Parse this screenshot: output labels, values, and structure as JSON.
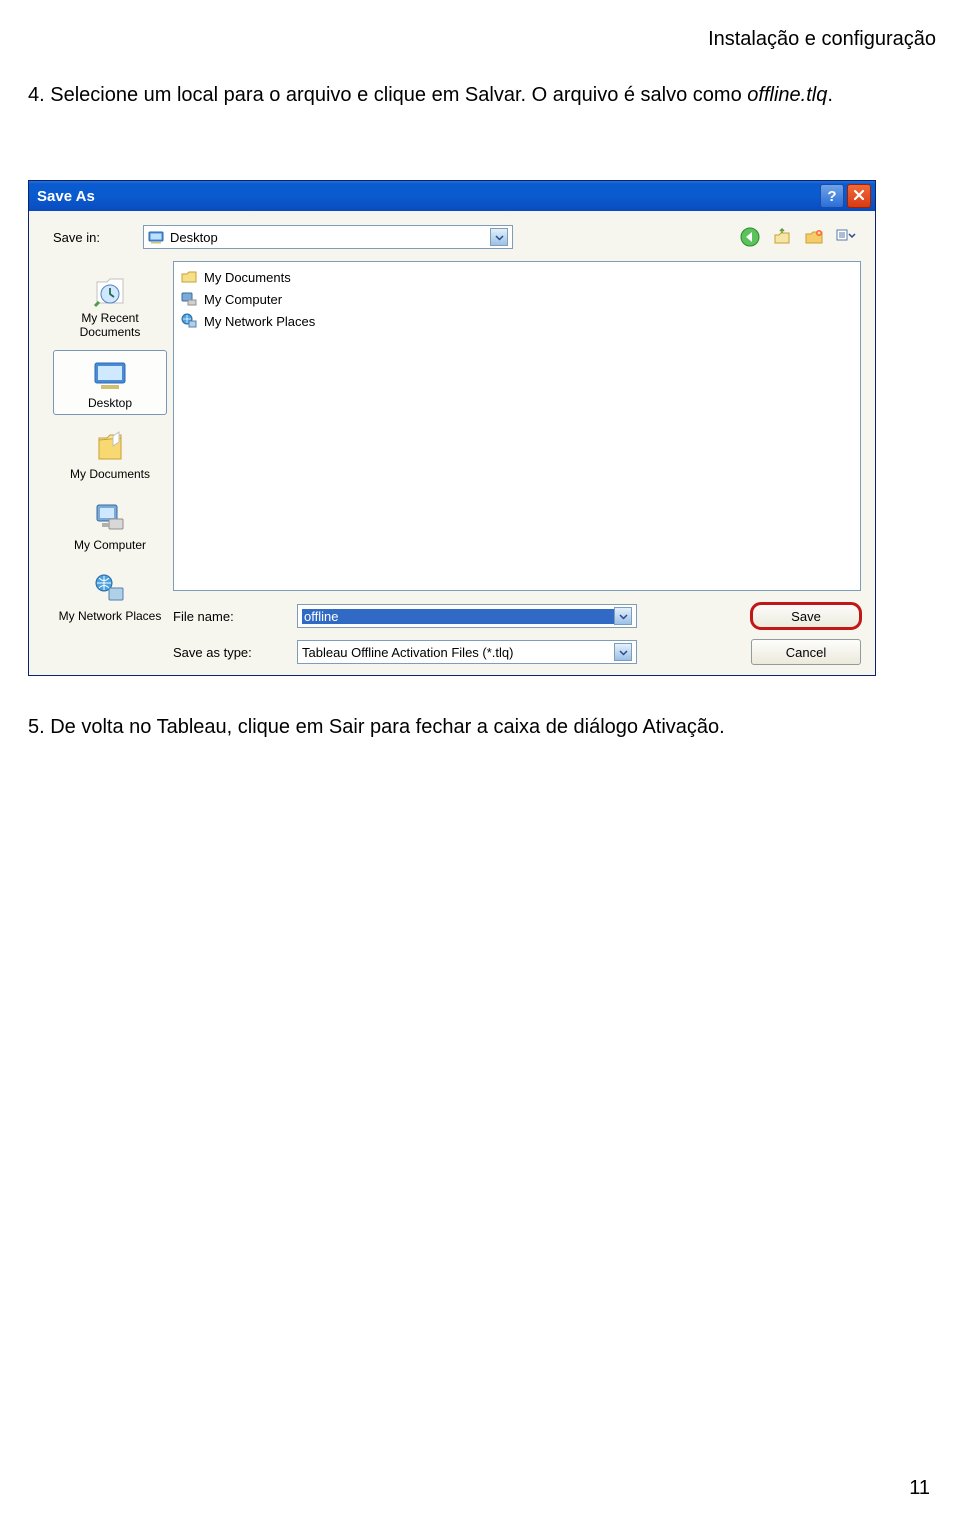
{
  "doc": {
    "header": "Instalação e configuração",
    "step4_a": "4.  Selecione um local para o arquivo e clique em Salvar. O arquivo é salvo como ",
    "step4_b": "offline.tlq",
    "step4_c": ".",
    "step5": "5.  De volta no Tableau, clique em Sair para fechar a caixa de diálogo Ativação.",
    "page_number": "11"
  },
  "dialog": {
    "title": "Save As",
    "savein_label": "Save in:",
    "savein_value": "Desktop",
    "places": [
      {
        "label": "My Recent Documents",
        "selected": false,
        "kind": "recent"
      },
      {
        "label": "Desktop",
        "selected": true,
        "kind": "desktop"
      },
      {
        "label": "My Documents",
        "selected": false,
        "kind": "mydocs"
      },
      {
        "label": "My Computer",
        "selected": false,
        "kind": "mycomputer"
      },
      {
        "label": "My Network Places",
        "selected": false,
        "kind": "network"
      }
    ],
    "file_items": [
      {
        "label": "My Documents",
        "kind": "folder"
      },
      {
        "label": "My Computer",
        "kind": "computer"
      },
      {
        "label": "My Network Places",
        "kind": "network"
      }
    ],
    "filename_label": "File name:",
    "filename_value": "offline",
    "filetype_label": "Save as type:",
    "filetype_value": "Tableau Offline Activation Files (*.tlq)",
    "btn_save": "Save",
    "btn_cancel": "Cancel"
  }
}
